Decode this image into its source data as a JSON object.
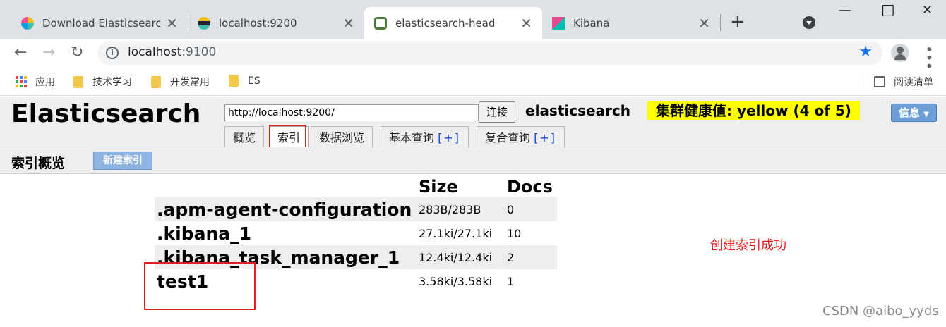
{
  "browser": {
    "tabs": [
      {
        "title": "Download Elasticsearch",
        "icon": "elastic-logo-icon"
      },
      {
        "title": "localhost:9200",
        "icon": "elastic-logo-icon"
      },
      {
        "title": "elasticsearch-head",
        "icon": "head-plugin-icon"
      },
      {
        "title": "Kibana",
        "icon": "kibana-logo-icon"
      }
    ],
    "url_host": "localhost",
    "url_port": ":9100",
    "bookmarks": [
      "应用",
      "技术学习",
      "开发常用",
      "ES"
    ],
    "reading_list": "阅读清单"
  },
  "header": {
    "logo": "Elasticsearch",
    "connect_url": "http://localhost:9200/",
    "connect_label": "连接",
    "cluster_name": "elasticsearch",
    "health": "集群健康值: yellow (4 of 5)",
    "health_color": "#ffff00",
    "info_label": "信息"
  },
  "tabs": [
    {
      "label": "概览"
    },
    {
      "label": "索引"
    },
    {
      "label": "数据浏览"
    },
    {
      "label": "基本查询",
      "extra": "[+]"
    },
    {
      "label": "复合查询",
      "extra": "[+]"
    }
  ],
  "overview": {
    "title": "索引概览",
    "new_index_label": "新建索引"
  },
  "index_table": {
    "headers": [
      "",
      "Size",
      "Docs"
    ],
    "rows": [
      {
        "name": ".apm-agent-configuration",
        "size": "283B/283B",
        "docs": "0"
      },
      {
        "name": ".kibana_1",
        "size": "27.1ki/27.1ki",
        "docs": "10"
      },
      {
        "name": ".kibana_task_manager_1",
        "size": "12.4ki/12.4ki",
        "docs": "2"
      },
      {
        "name": "test1",
        "size": "3.58ki/3.58ki",
        "docs": "1"
      }
    ]
  },
  "annotation": {
    "note": "创建索引成功",
    "color": "#e01c1c"
  },
  "watermark": "CSDN @aibo_yyds"
}
